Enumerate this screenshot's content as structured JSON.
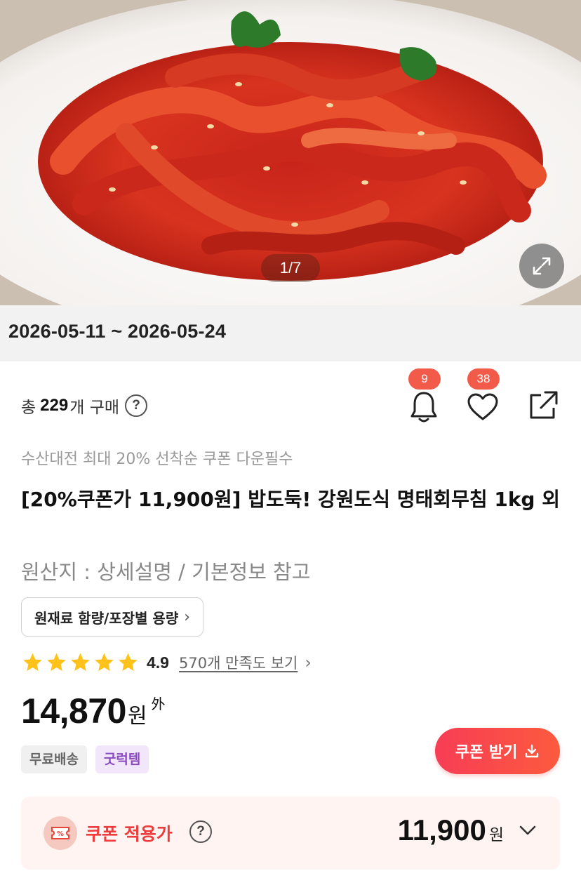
{
  "hero": {
    "pager": "1/7"
  },
  "event_period": "2026-05-11 ~ 2026-05-24",
  "purchase": {
    "prefix": "총",
    "count": "229",
    "suffix": "개 구매",
    "help_icon": "?"
  },
  "actions": {
    "alarm_count": "9",
    "wish_count": "38",
    "icons": [
      "bell-icon",
      "heart-icon",
      "share-icon"
    ]
  },
  "promo_text": "수산대전 최대 20% 선착순 쿠폰 다운필수",
  "title": "[20%쿠폰가 11,900원] 밥도둑! 강원도식 명태회무침 1kg 외",
  "origin": "원산지 : 상세설명 / 기본정보 참고",
  "ingredient_button": "원재료 함량/포장별 용량",
  "rating": {
    "score": "4.9",
    "stars": 5,
    "review_link": "570개 만족도 보기",
    "star_color": "#ffc21a"
  },
  "price": {
    "value": "14,870",
    "unit": "원",
    "etc": "外"
  },
  "tags": [
    "무료배송",
    "굿럭템"
  ],
  "coupon_button": "쿠폰 받기",
  "coupon_price": {
    "label": "쿠폰 적용가",
    "help_icon": "?",
    "value": "11,900",
    "unit": "원"
  },
  "colors": {
    "accent": "#f73d55",
    "badge": "#f25a4a",
    "coupon_text": "#ee3b3b"
  }
}
